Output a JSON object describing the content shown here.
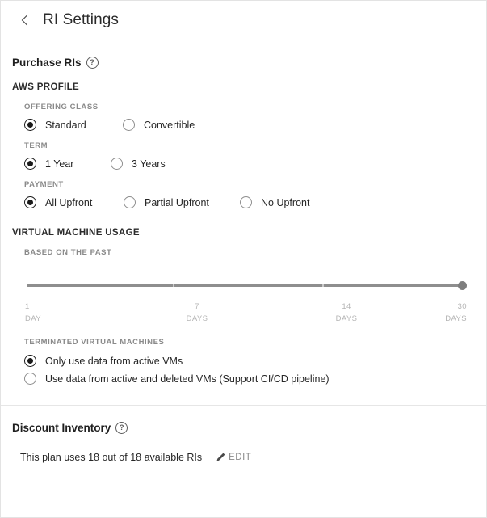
{
  "header": {
    "back_icon": "chevron-left-icon",
    "title": "RI Settings"
  },
  "purchase_section": {
    "title": "Purchase RIs",
    "help_icon": "help-circle-icon",
    "aws_profile": {
      "title": "AWS PROFILE",
      "offering_class": {
        "label": "OFFERING CLASS",
        "options": [
          {
            "label": "Standard",
            "selected": true
          },
          {
            "label": "Convertible",
            "selected": false
          }
        ]
      },
      "term": {
        "label": "TERM",
        "options": [
          {
            "label": "1 Year",
            "selected": true
          },
          {
            "label": "3 Years",
            "selected": false
          }
        ]
      },
      "payment": {
        "label": "PAYMENT",
        "options": [
          {
            "label": "All Upfront",
            "selected": true
          },
          {
            "label": "Partial Upfront",
            "selected": false
          },
          {
            "label": "No Upfront",
            "selected": false
          }
        ]
      }
    },
    "vm_usage": {
      "title": "VIRTUAL MACHINE USAGE",
      "slider": {
        "label": "BASED ON THE PAST",
        "value": 30,
        "min": 1,
        "max": 30,
        "ticks": [
          {
            "value": "1",
            "unit": "DAY"
          },
          {
            "value": "7",
            "unit": "DAYS"
          },
          {
            "value": "14",
            "unit": "DAYS"
          },
          {
            "value": "30",
            "unit": "DAYS"
          }
        ]
      },
      "terminated_vms": {
        "label": "TERMINATED VIRTUAL MACHINES",
        "options": [
          {
            "label": "Only use data from active VMs",
            "selected": true
          },
          {
            "label": "Use data from active and deleted VMs (Support CI/CD pipeline)",
            "selected": false
          }
        ]
      }
    }
  },
  "discount_inventory": {
    "title": "Discount Inventory",
    "help_icon": "help-circle-icon",
    "summary": "This plan uses 18 out of 18 available RIs",
    "edit_label": "EDIT",
    "edit_icon": "pencil-icon"
  }
}
